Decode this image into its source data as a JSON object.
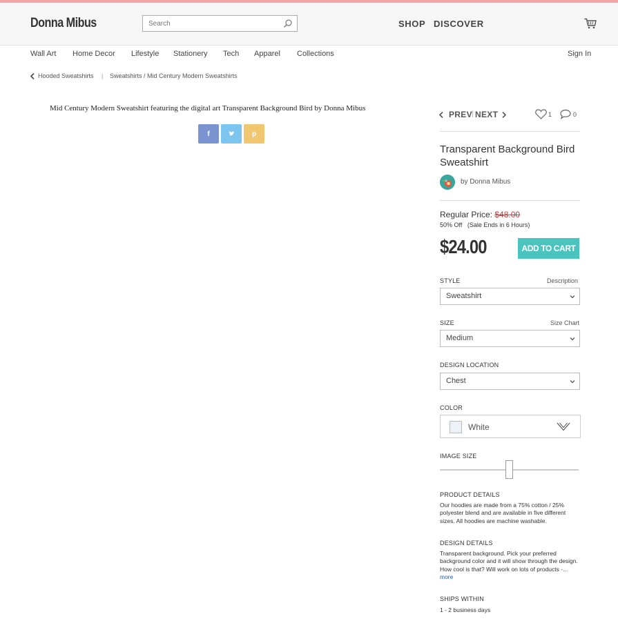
{
  "brand": "Donna Mibus",
  "search": {
    "placeholder": "Search"
  },
  "topnav": {
    "shop": "SHOP",
    "discover": "DISCOVER"
  },
  "subnav": {
    "items": [
      "Wall Art",
      "Home Decor",
      "Lifestyle",
      "Stationery",
      "Tech",
      "Apparel",
      "Collections"
    ],
    "sign_in": "Sign In"
  },
  "breadcrumb": {
    "back": "Hooded Sweatshirts",
    "path": "Sweatshirts / Mid Century Modern Sweatshirts"
  },
  "artwork": {
    "title": "Mid Century Modern Sweatshirt featuring the digital art Transparent Background Bird by Donna Mibus"
  },
  "share": {
    "facebook": "f",
    "twitter": "t",
    "pinterest": "p"
  },
  "product_nav": {
    "prev": "PREV",
    "separator": "|",
    "next": "NEXT",
    "likes": "1",
    "comments": "0"
  },
  "product": {
    "title": "Transparent Background Bird Sweatshirt",
    "artist": "by Donna Mibus",
    "regular_price_label": "Regular Price:",
    "regular_price": "$48.00",
    "discount": "50% Off",
    "sale_note": "(Sale Ends in 6 Hours)",
    "price": "$24.00",
    "add_to_cart": "ADD TO CART"
  },
  "options": {
    "style_label": "STYLE",
    "style_link": "Description",
    "style_value": "Sweatshirt",
    "size_label": "SIZE",
    "size_link": "Size Chart",
    "size_value": "Medium",
    "location_label": "DESIGN LOCATION",
    "location_value": "Chest",
    "color_label": "COLOR",
    "color_value": "White",
    "image_size_label": "IMAGE SIZE",
    "image_size_level": 0.5
  },
  "details": {
    "product_label": "PRODUCT DETAILS",
    "product_text": "Our hoodies are made from a 75% cotton / 25% polyester blend and are available in five different sizes.   All hoodies are machine washable.",
    "design_label": "DESIGN DETAILS",
    "design_text": "Transparent background. Pick your preferred background color and it will show through the design. How cool is that? Will work on lots of products -...",
    "design_more": "more",
    "ships_label": "SHIPS WITHIN",
    "ships_text": "1 - 2 business days"
  },
  "colors": {
    "accent": "#4bc4bf",
    "topline": "#f3a5a5",
    "facebook": "#7b93cf",
    "twitter": "#7cc5ee",
    "pinterest": "#f0c770",
    "strike_price": "#cc3333"
  }
}
